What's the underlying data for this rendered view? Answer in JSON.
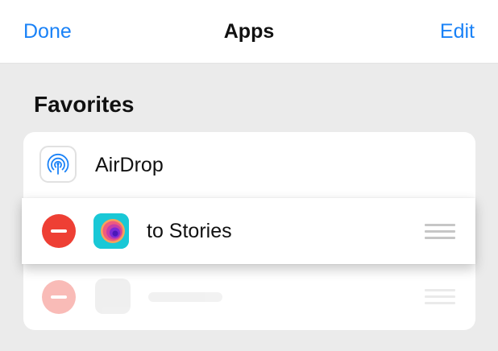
{
  "navbar": {
    "done_label": "Done",
    "title": "Apps",
    "edit_label": "Edit"
  },
  "favorites": {
    "section_title": "Favorites",
    "items": [
      {
        "label": "AirDrop",
        "icon": "airdrop-icon"
      },
      {
        "label": "to Stories",
        "icon": "stories-app-icon",
        "state": "dragging"
      },
      {
        "label": "",
        "icon": "placeholder-app-icon",
        "state": "drop-placeholder"
      }
    ]
  },
  "colors": {
    "accent": "#1a82f7",
    "delete": "#ee3f34",
    "background": "#ebebeb",
    "card": "#ffffff"
  }
}
